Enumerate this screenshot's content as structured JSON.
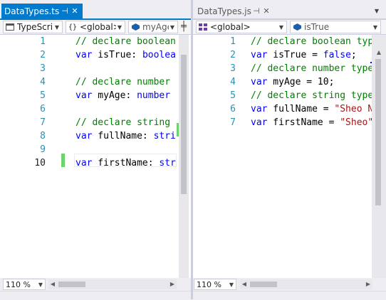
{
  "colors": {
    "accent": "#007acc",
    "comment": "#008000",
    "keyword": "#0000ff",
    "string": "#a31515",
    "line_number": "#2b91af",
    "change_bar": "#6dd36d"
  },
  "left": {
    "tab": {
      "label": "DataTypes.ts",
      "pin": "⊣",
      "close": "✕"
    },
    "nav": {
      "project": "TypeScrip",
      "scope": "<global>",
      "member": "myAge"
    },
    "lines": [
      "1",
      "2",
      "3",
      "4",
      "5",
      "6",
      "7",
      "8",
      "9",
      "10"
    ],
    "code": [
      [
        {
          "t": "// declare boolean",
          "c": "cmt"
        }
      ],
      [
        {
          "t": "var",
          "c": "kw"
        },
        {
          "t": " isTrue: ",
          "c": "txt"
        },
        {
          "t": "boolea",
          "c": "kw"
        }
      ],
      [],
      [
        {
          "t": "// declare number",
          "c": "cmt"
        }
      ],
      [
        {
          "t": "var",
          "c": "kw"
        },
        {
          "t": " myAge: ",
          "c": "txt"
        },
        {
          "t": "number",
          "c": "kw"
        }
      ],
      [],
      [
        {
          "t": "// declare string",
          "c": "cmt"
        }
      ],
      [
        {
          "t": "var",
          "c": "kw"
        },
        {
          "t": " fullName: ",
          "c": "txt"
        },
        {
          "t": "stri",
          "c": "kw"
        }
      ],
      [],
      [
        {
          "t": "var",
          "c": "kw"
        },
        {
          "t": " firstName: ",
          "c": "txt"
        },
        {
          "t": "str",
          "c": "kw"
        }
      ]
    ],
    "zoom": "110 %"
  },
  "right": {
    "tab": {
      "label": "DataTypes.js",
      "pin": "⊣",
      "close": "✕"
    },
    "nav": {
      "scope": "<global>",
      "member": "isTrue"
    },
    "lines": [
      "1",
      "2",
      "3",
      "4",
      "5",
      "6",
      "7"
    ],
    "code": [
      [
        {
          "t": "// declare boolean typ",
          "c": "cmt"
        }
      ],
      [
        {
          "t": "var",
          "c": "kw"
        },
        {
          "t": " isTrue = ",
          "c": "txt"
        },
        {
          "t": "false",
          "c": "kw"
        },
        {
          "t": ";",
          "c": "txt"
        }
      ],
      [
        {
          "t": "// declare number type",
          "c": "cmt"
        }
      ],
      [
        {
          "t": "var",
          "c": "kw"
        },
        {
          "t": " myAge = 10;",
          "c": "txt"
        }
      ],
      [
        {
          "t": "// declare string type",
          "c": "cmt"
        }
      ],
      [
        {
          "t": "var",
          "c": "kw"
        },
        {
          "t": " fullName = ",
          "c": "txt"
        },
        {
          "t": "\"Sheo N",
          "c": "str"
        }
      ],
      [
        {
          "t": "var",
          "c": "kw"
        },
        {
          "t": " firstName = ",
          "c": "txt"
        },
        {
          "t": "\"Sheo\"",
          "c": "str"
        }
      ]
    ],
    "zoom": "110 %"
  }
}
